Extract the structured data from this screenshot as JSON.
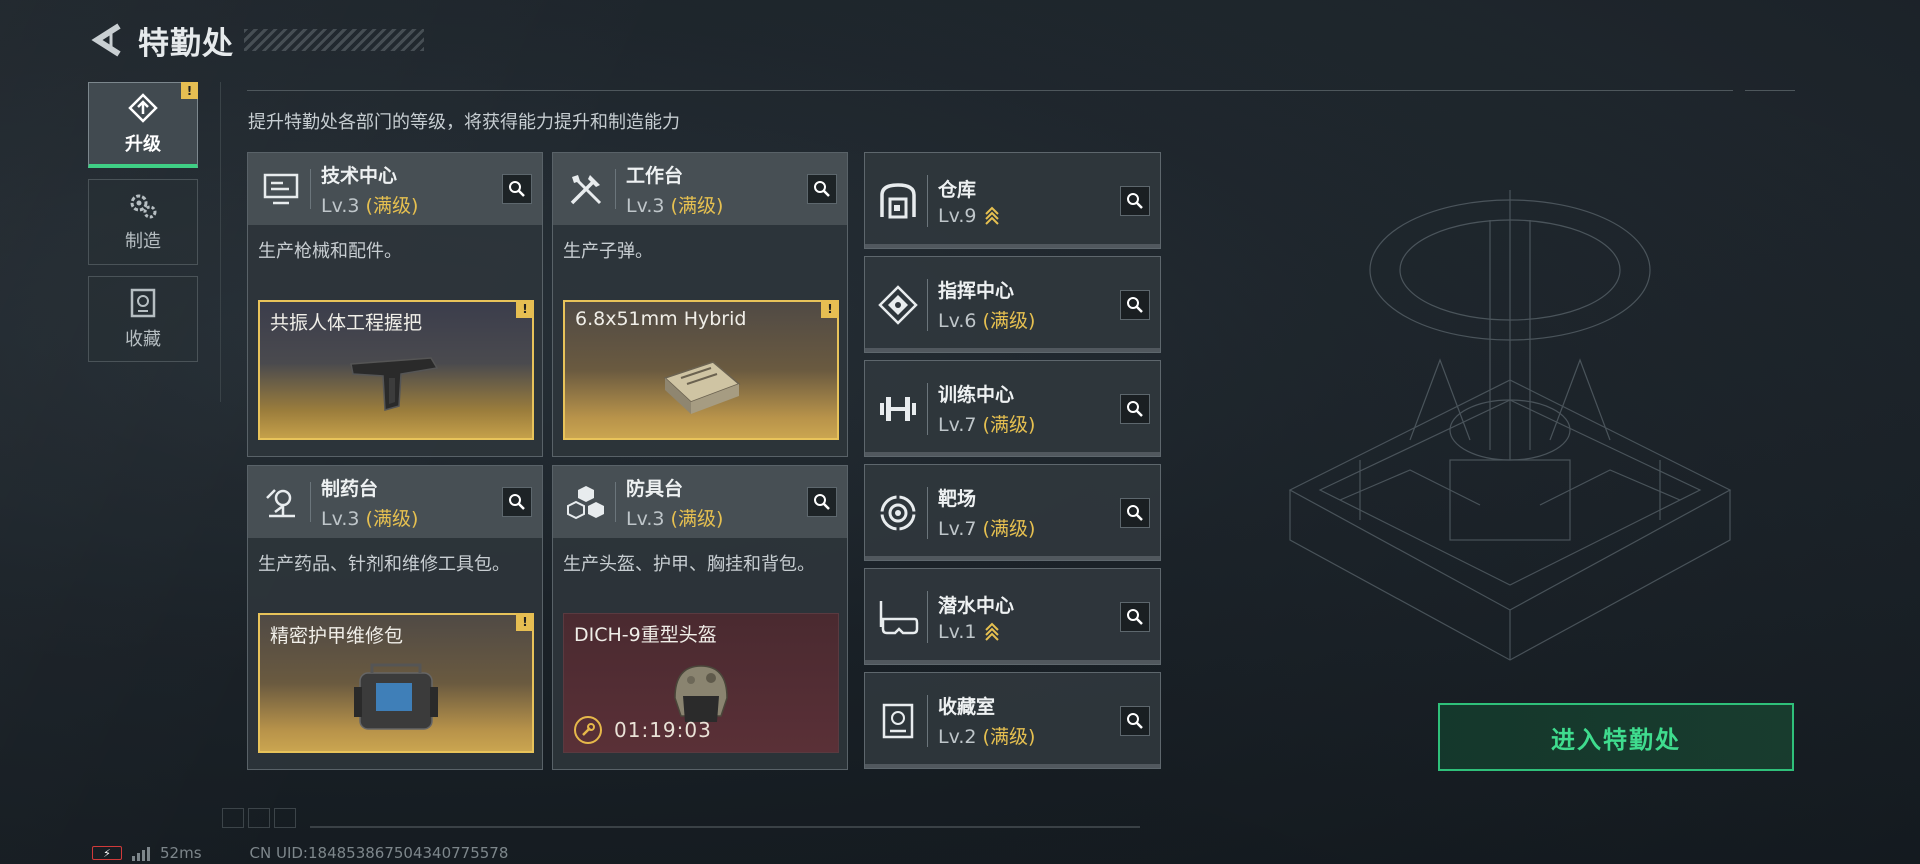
{
  "header": {
    "title": "特勤处"
  },
  "nav": [
    {
      "label": "升级",
      "icon": "upgrade-icon",
      "active": true,
      "badge": "!"
    },
    {
      "label": "制造",
      "icon": "gears-icon",
      "active": false
    },
    {
      "label": "收藏",
      "icon": "collection-icon",
      "active": false
    }
  ],
  "subtitle": "提升特勤处各部门的等级，将获得能力提升和制造能力",
  "cards": [
    {
      "name": "技术中心",
      "level": "Lv.3",
      "max": "(满级)",
      "icon": "tech-center-icon",
      "desc": "生产枪械和配件。",
      "craft": {
        "name": "共振人体工程握把",
        "badge": "!",
        "item_icon": "grip-icon"
      }
    },
    {
      "name": "工作台",
      "level": "Lv.3",
      "max": "(满级)",
      "icon": "tools-icon",
      "desc": "生产子弹。",
      "craft": {
        "name": "6.8x51mm Hybrid",
        "badge": "!",
        "item_icon": "ammo-box-icon"
      }
    },
    {
      "name": "制药台",
      "level": "Lv.3",
      "max": "(满级)",
      "icon": "microscope-icon",
      "desc": "生产药品、针剂和维修工具包。",
      "craft": {
        "name": "精密护甲维修包",
        "badge": "!",
        "item_icon": "repair-kit-icon"
      }
    },
    {
      "name": "防具台",
      "level": "Lv.3",
      "max": "(满级)",
      "icon": "armor-cubes-icon",
      "desc": "生产头盔、护甲、胸挂和背包。",
      "craft": {
        "name": "DICH-9重型头盔",
        "timer": "01:19:03",
        "item_icon": "helmet-icon"
      }
    }
  ],
  "rooms": [
    {
      "name": "仓库",
      "level": "Lv.9",
      "max": "",
      "upgradable": true,
      "icon": "warehouse-icon"
    },
    {
      "name": "指挥中心",
      "level": "Lv.6",
      "max": "(满级)",
      "upgradable": false,
      "icon": "command-icon"
    },
    {
      "name": "训练中心",
      "level": "Lv.7",
      "max": "(满级)",
      "upgradable": false,
      "icon": "dumbbell-icon"
    },
    {
      "name": "靶场",
      "level": "Lv.7",
      "max": "(满级)",
      "upgradable": false,
      "icon": "target-icon"
    },
    {
      "name": "潜水中心",
      "level": "Lv.1",
      "max": "",
      "upgradable": true,
      "icon": "goggles-icon"
    },
    {
      "name": "收藏室",
      "level": "Lv.2",
      "max": "(满级)",
      "upgradable": false,
      "icon": "vault-icon"
    }
  ],
  "enter_button": "进入特勤处",
  "footer": {
    "ping": "52ms",
    "uid": "CN UID:184853867504340775578"
  },
  "colors": {
    "accent": "#3fcf85",
    "gold": "#e6c050",
    "badge": "#e6be52"
  }
}
